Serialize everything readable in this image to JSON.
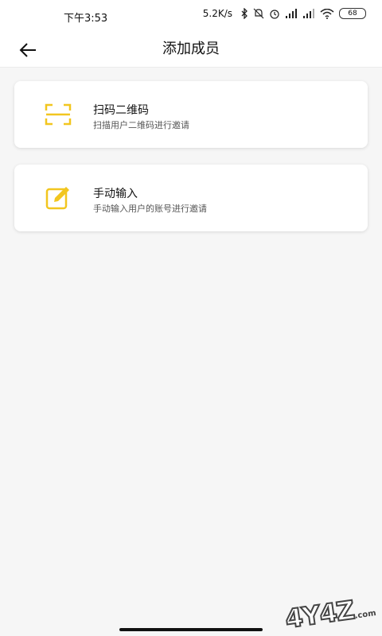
{
  "status_bar": {
    "time": "下午3:53",
    "net_speed": "5.2K/s",
    "battery": "68",
    "icons": [
      "bluetooth-icon",
      "mute-icon",
      "alarm-icon",
      "signal-icon",
      "signal-hd-icon",
      "wifi-icon",
      "battery-icon"
    ]
  },
  "header": {
    "title": "添加成员",
    "back_icon": "back-arrow-icon"
  },
  "options": [
    {
      "title": "扫码二维码",
      "subtitle": "扫描用户二维码进行邀请",
      "icon": "scan-icon"
    },
    {
      "title": "手动输入",
      "subtitle": "手动输入用户的账号进行邀请",
      "icon": "edit-icon"
    }
  ],
  "colors": {
    "accent": "#f2c61f",
    "background": "#f6f6f6",
    "card": "#ffffff"
  },
  "watermark": {
    "text": "4Y4Z",
    "suffix": ".com"
  }
}
